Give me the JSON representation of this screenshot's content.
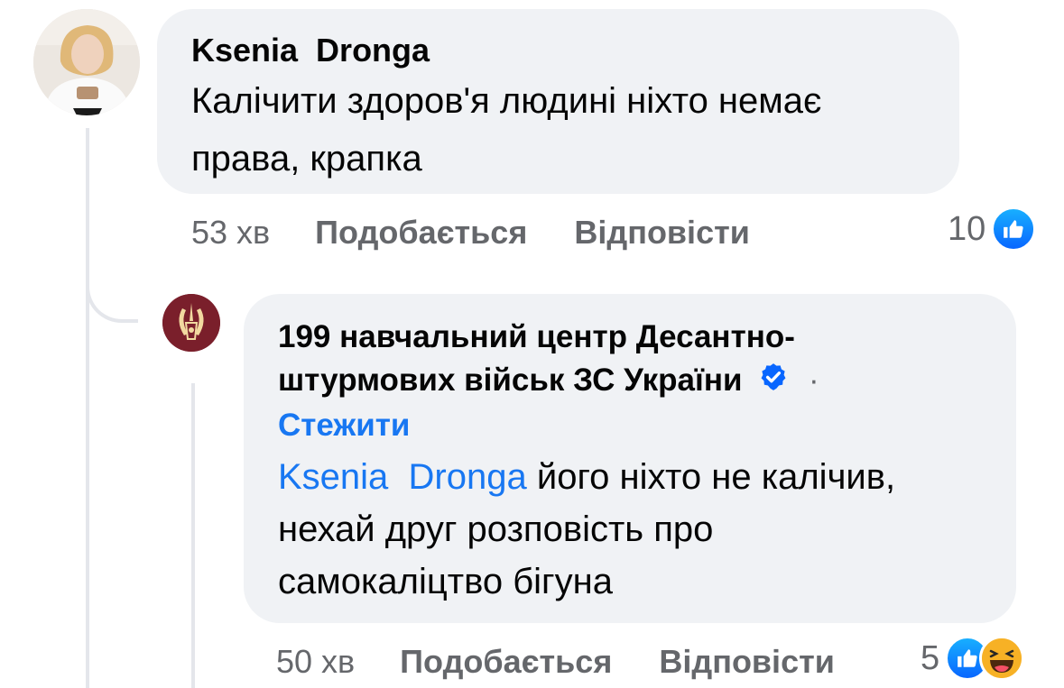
{
  "comments": [
    {
      "author": "Ksenia  Dronga",
      "text": "Калічити здоров'я людині ніхто немає права, крапка",
      "time": "53 хв",
      "like_label": "Подобається",
      "reply_label": "Відповісти",
      "reaction_count": "10",
      "reactions": [
        "like-icon"
      ]
    },
    {
      "author": "199 навчальний центр Десантно-штурмових військ ЗС України",
      "author_line1": "199 навчальний центр Десантно-",
      "author_line2": "штурмових військ ЗС України",
      "separator": "·",
      "follow_label": "Стежити",
      "mention": "Ksenia  Dronga",
      "text_line1": " його ніхто не калічив,",
      "text_line2": "нехай друг розповість про",
      "text_line3": "самокаліцтво бігуна",
      "time": "50 хв",
      "like_label": "Подобається",
      "reply_label": "Відповісти",
      "reaction_count": "5",
      "reactions": [
        "like-icon",
        "haha-icon"
      ]
    }
  ],
  "colors": {
    "bubble": "#f0f2f5",
    "link": "#1877f2",
    "meta": "#65676b",
    "emblem": "#7a1f2b"
  }
}
